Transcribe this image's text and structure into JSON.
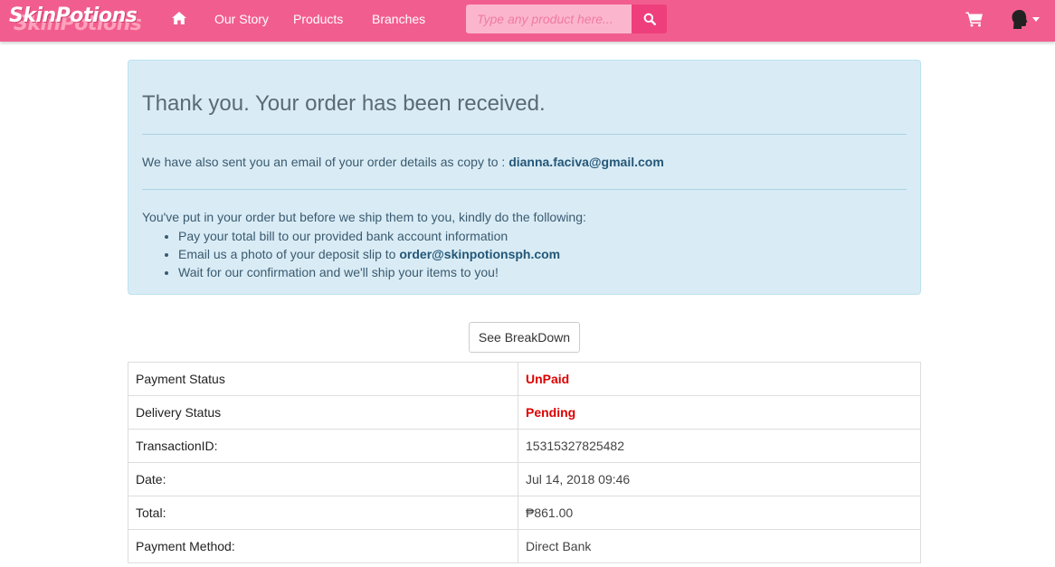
{
  "navbar": {
    "brand": "SkinPotions",
    "links": [
      "Our Story",
      "Products",
      "Branches"
    ],
    "search_placeholder": "Type any product here...",
    "colors": {
      "bar": "#f25d8f",
      "search_button": "#ee3f7c"
    },
    "icons": [
      "home-icon",
      "search-icon",
      "cart-icon",
      "user-icon",
      "caret-down-icon"
    ]
  },
  "alert": {
    "title": "Thank you. Your order has been received.",
    "email_prefix": "We have also sent you an email of your order details as copy to : ",
    "email": "dianna.faciva@gmail.com",
    "instructions_intro": "You've put in your order but before we ship them to you, kindly do the following:",
    "steps": [
      "Pay your total bill to our provided bank account information",
      "Email us a photo of your deposit slip to ",
      "Wait for our confirmation and we'll ship your items to you!"
    ],
    "deposit_email": "order@skinpotionsph.com"
  },
  "breakdown_button": "See BreakDown",
  "order_details": {
    "rows": [
      {
        "label": "Payment Status",
        "value": "UnPaid"
      },
      {
        "label": "Delivery Status",
        "value": "Pending"
      },
      {
        "label": "TransactionID:",
        "value": "15315327825482"
      },
      {
        "label": "Date:",
        "value": "Jul 14, 2018 09:46"
      },
      {
        "label": "Total:",
        "value": "₱861.00"
      },
      {
        "label": "Payment Method:",
        "value": "Direct Bank"
      }
    ],
    "status_color": "#dd0000"
  }
}
